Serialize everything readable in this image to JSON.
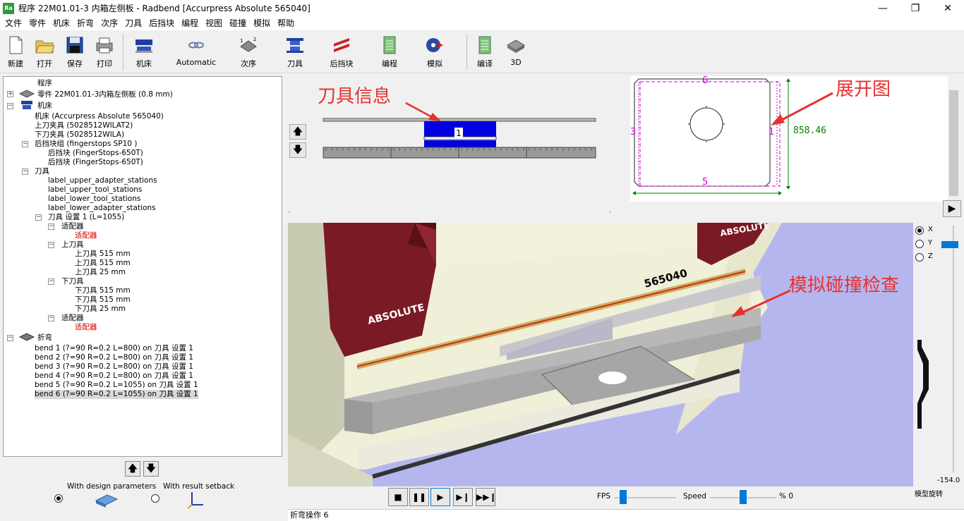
{
  "window": {
    "title": "程序 22M01.01-3 内箱左侧板 - Radbend [Accurpress Absolute 565040]",
    "icon_text": "Ra",
    "controls": [
      "minimize-icon",
      "restore-icon",
      "close-icon"
    ]
  },
  "menu": [
    "文件",
    "零件",
    "机床",
    "折弯",
    "次序",
    "刀具",
    "后挡块",
    "编程",
    "视图",
    "碰撞",
    "模拟",
    "帮助"
  ],
  "toolbar": {
    "new": "新建",
    "open": "打开",
    "save": "保存",
    "print": "打印",
    "machine": "机床",
    "automatic": "Automatic",
    "sequence": "次序",
    "tools": "刀具",
    "backgauge": "后挡块",
    "program": "编程",
    "simulate": "模拟",
    "compile": "编译",
    "view3d": "3D"
  },
  "tree": {
    "root": "程序",
    "part": "零件 22M01.01-3内箱左侧板 (0.8 mm)",
    "machine": "机床",
    "machine_model": "机床 (Accurpress Absolute 565040)",
    "upper_clamp": "上刀夹具 (5028512WILAT2)",
    "lower_clamp": "下刀夹具 (5028512WILA)",
    "bg_group": "后挡块组 (fingerstops SP10 )",
    "bg1": "后挡块 (FingerStops-650T)",
    "bg2": "后挡块 (FingerStops-650T)",
    "tools": "刀具",
    "label_upper_adapter": "label_upper_adapter_stations",
    "label_upper_tool": "label_upper_tool_stations",
    "label_lower_tool": "label_lower_tool_stations",
    "label_lower_adapter": "label_lower_adapter_stations",
    "tool_setup": "刀具 设置 1 (L=1055)",
    "adapter": "适配器",
    "adapter_red": "适配器",
    "upper_tools": "上刀具",
    "ut1": "上刀具 515 mm",
    "ut2": "上刀具 515 mm",
    "ut3": "上刀具 25 mm",
    "lower_tools": "下刀具",
    "lt1": "下刀具 515 mm",
    "lt2": "下刀具 515 mm",
    "lt3": "下刀具 25 mm",
    "adapter2": "适配器",
    "adapter2_red": "适配器",
    "bends_label": "折弯",
    "bends": [
      "bend 1 (?=90 R=0.2 L=800) on 刀具 设置 1",
      "bend 2 (?=90 R=0.2 L=800) on 刀具 设置 1",
      "bend 3 (?=90 R=0.2 L=800) on 刀具 设置 1",
      "bend 4 (?=90 R=0.2 L=800) on 刀具 设置 1",
      "bend 5 (?=90 R=0.2 L=1055) on 刀具 设置 1",
      "bend 6 (?=90 R=0.2 L=1055) on 刀具 设置 1"
    ]
  },
  "left_bottom": {
    "design_label": "With design parameters",
    "setback_label": "With result setback",
    "selected": "design"
  },
  "tool_view": {
    "station_number": "1",
    "annotation": "刀具信息"
  },
  "unfold": {
    "top_num": "6",
    "bottom_num": "5",
    "left_num": "3",
    "right_num": "1",
    "dimension": "858.46",
    "annotation": "展开图"
  },
  "view3d": {
    "machine_number": "565040",
    "brand": "ABSOLUTE",
    "brand2": "ABSOLUTE",
    "annotation": "模拟碰撞检查"
  },
  "axis": {
    "x": "X",
    "y": "Y",
    "z": "Z",
    "selected": "X",
    "value": "-154.0",
    "label": "模型旋转"
  },
  "playback": {
    "fps_label": "FPS",
    "speed_label": "Speed",
    "percent_label": "% 0",
    "fps_value": 0.15,
    "speed_value": 0.5
  },
  "status": "折弯操作 6",
  "colors": {
    "machine_red": "#7a1a24",
    "view_bg": "#b6b6ee",
    "annotation": "#e83030",
    "unfold_magenta": "#d000d0",
    "unfold_green": "#008000"
  }
}
